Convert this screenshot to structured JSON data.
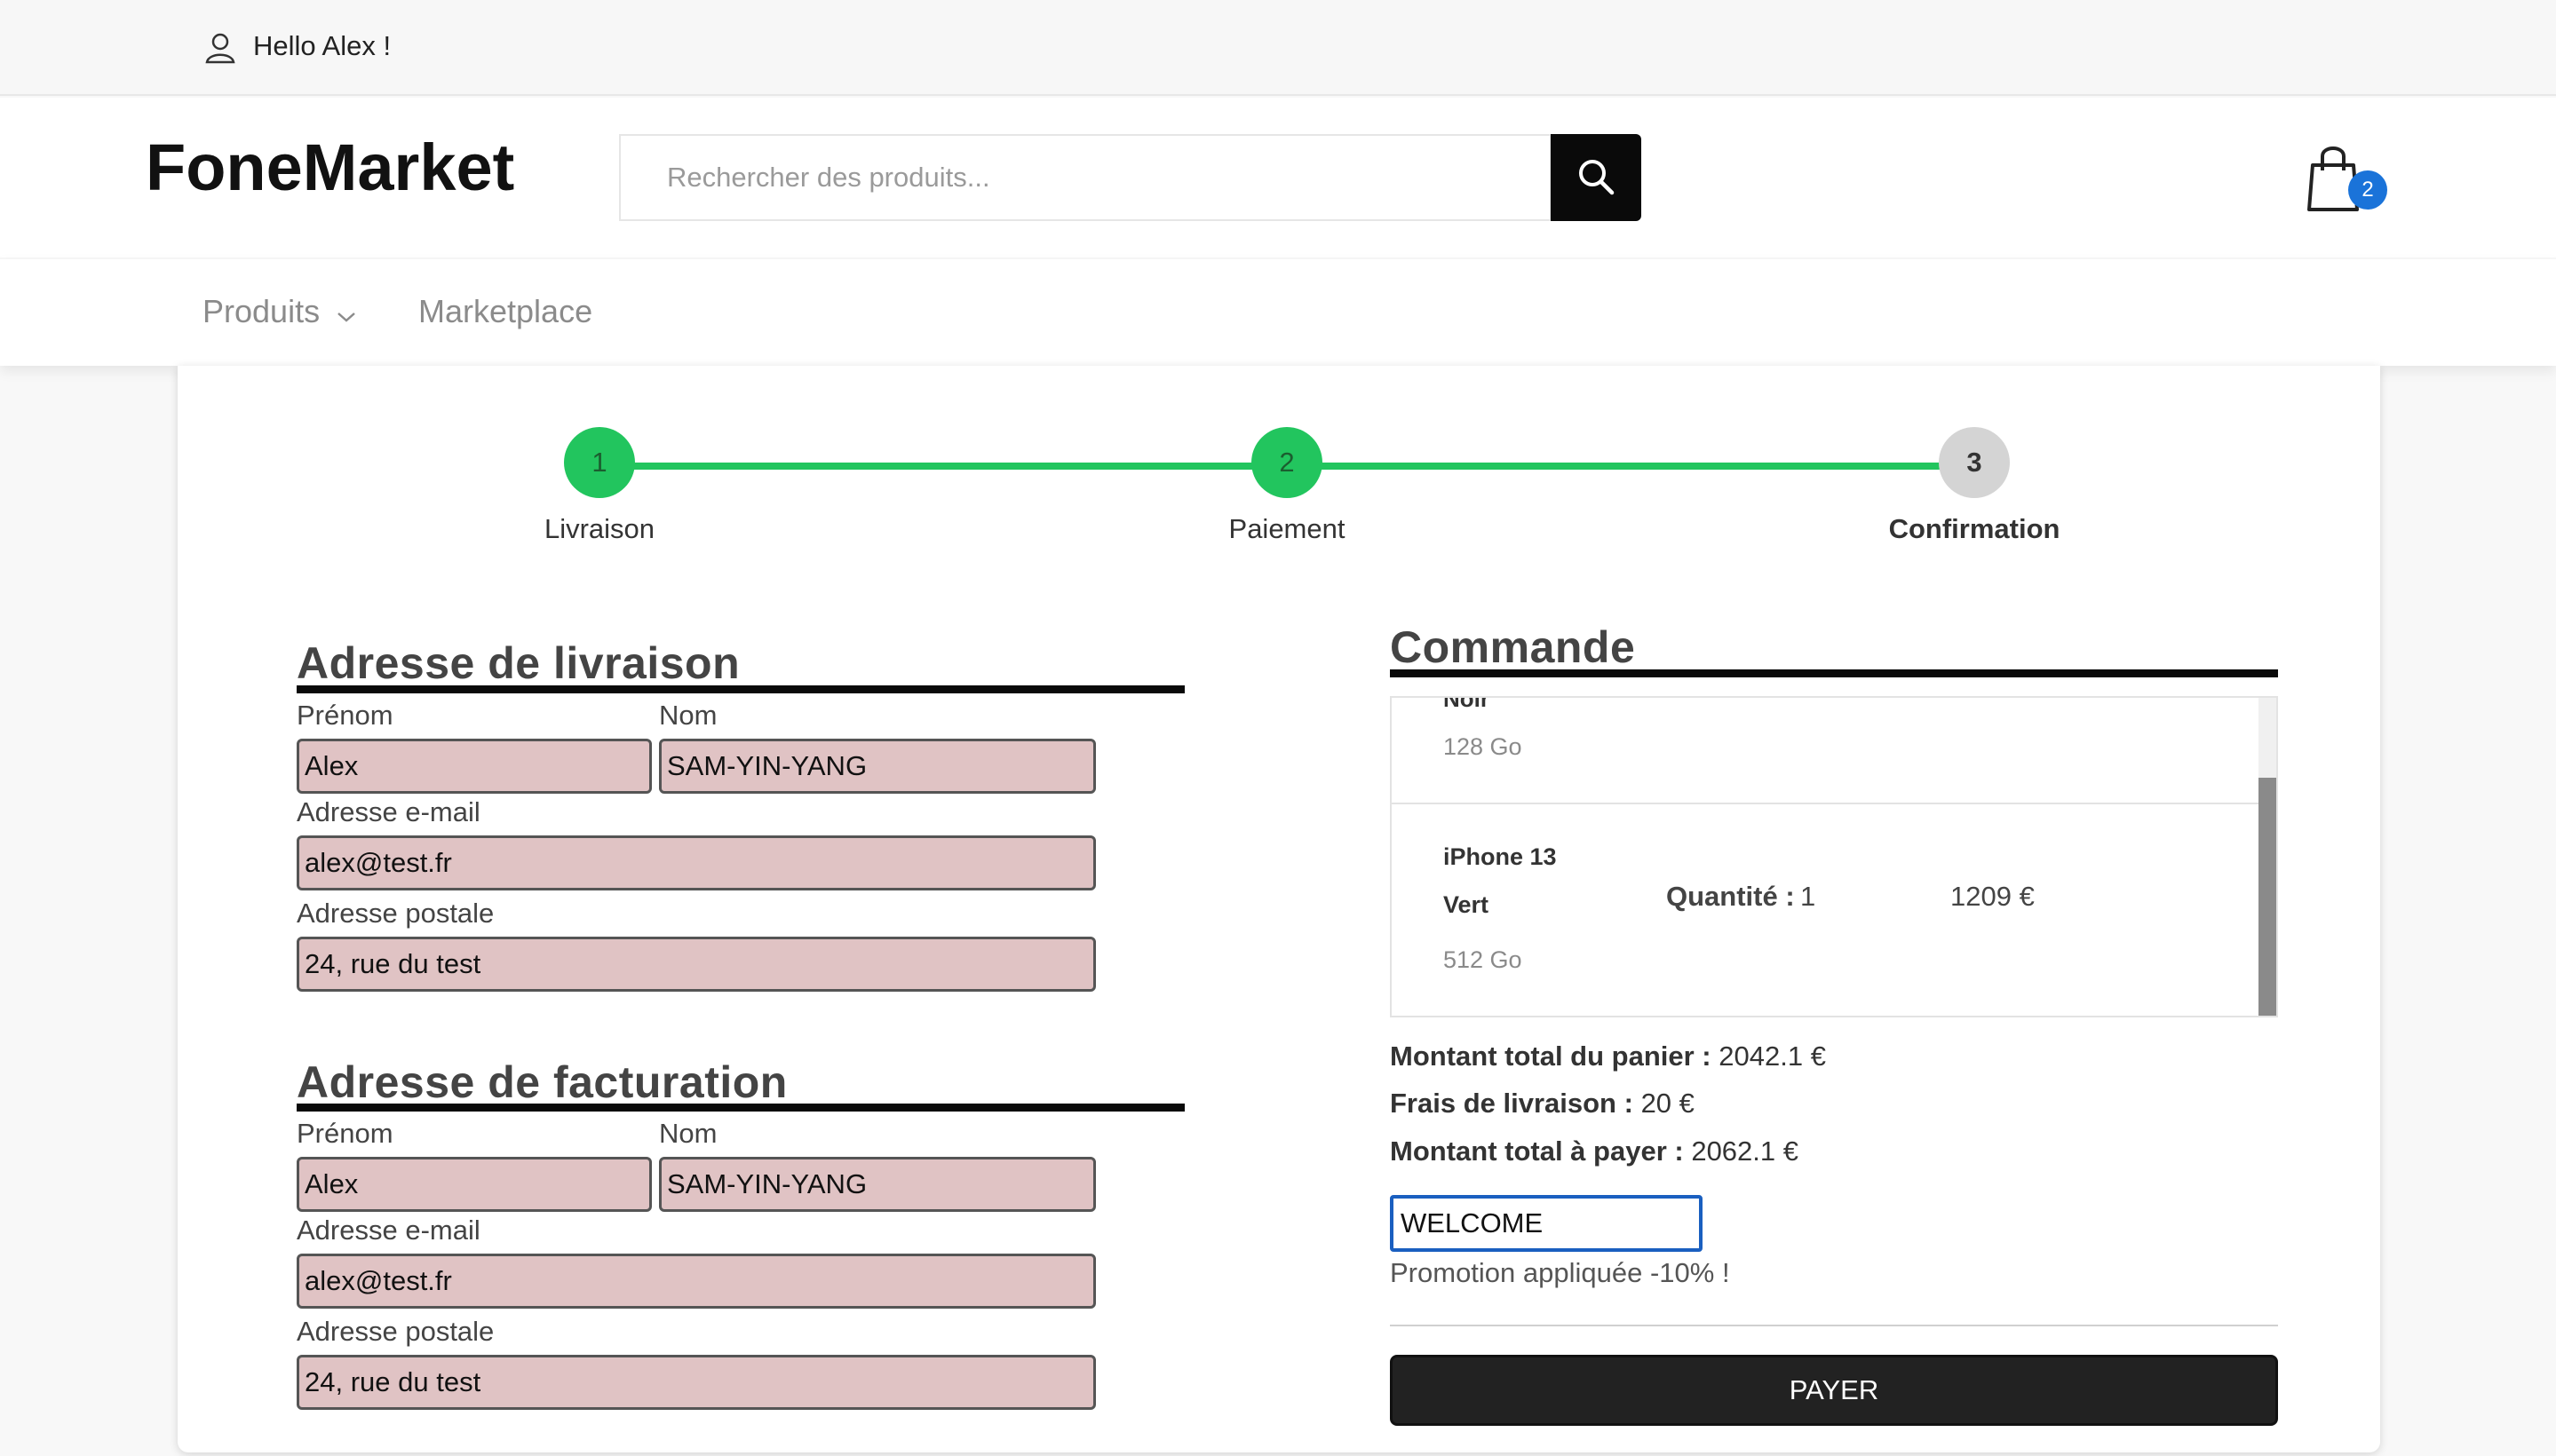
{
  "topbar": {
    "greeting": "Hello Alex !"
  },
  "header": {
    "logo": "FoneMarket",
    "search_placeholder": "Rechercher des produits...",
    "cart_count": "2"
  },
  "nav": {
    "items": [
      "Produits",
      "Marketplace"
    ]
  },
  "stepper": {
    "steps": [
      {
        "number": "1",
        "label": "Livraison",
        "state": "done"
      },
      {
        "number": "2",
        "label": "Paiement",
        "state": "done"
      },
      {
        "number": "3",
        "label": "Confirmation",
        "state": "current"
      }
    ],
    "colors": {
      "done": "#22c55e",
      "todo": "#d4d4d4"
    }
  },
  "shipping": {
    "title": "Adresse de livraison",
    "labels": {
      "first_name": "Prénom",
      "last_name": "Nom",
      "email": "Adresse e-mail",
      "address": "Adresse postale"
    },
    "values": {
      "first_name": "Alex",
      "last_name": "SAM-YIN-YANG",
      "email": "alex@test.fr",
      "address": "24, rue du test"
    }
  },
  "billing": {
    "title": "Adresse de facturation",
    "labels": {
      "first_name": "Prénom",
      "last_name": "Nom",
      "email": "Adresse e-mail",
      "address": "Adresse postale"
    },
    "values": {
      "first_name": "Alex",
      "last_name": "SAM-YIN-YANG",
      "email": "alex@test.fr",
      "address": "24, rue du test"
    }
  },
  "order": {
    "title": "Commande",
    "items": [
      {
        "name_cut": "Noir",
        "storage": "128 Go"
      },
      {
        "name": "iPhone 13",
        "color": "Vert",
        "storage": "512 Go",
        "qty_label": "Quantité :",
        "qty": "1",
        "price": "1209 €"
      }
    ],
    "totals": {
      "cart_label": "Montant total du panier :",
      "cart_value": "2042.1 €",
      "shipping_label": "Frais de livraison :",
      "shipping_value": "20 €",
      "pay_label": "Montant total à payer :",
      "pay_value": "2062.1 €"
    },
    "promo": {
      "code": "WELCOME",
      "message": "Promotion appliquée -10% !"
    },
    "pay_button": "PAYER"
  }
}
